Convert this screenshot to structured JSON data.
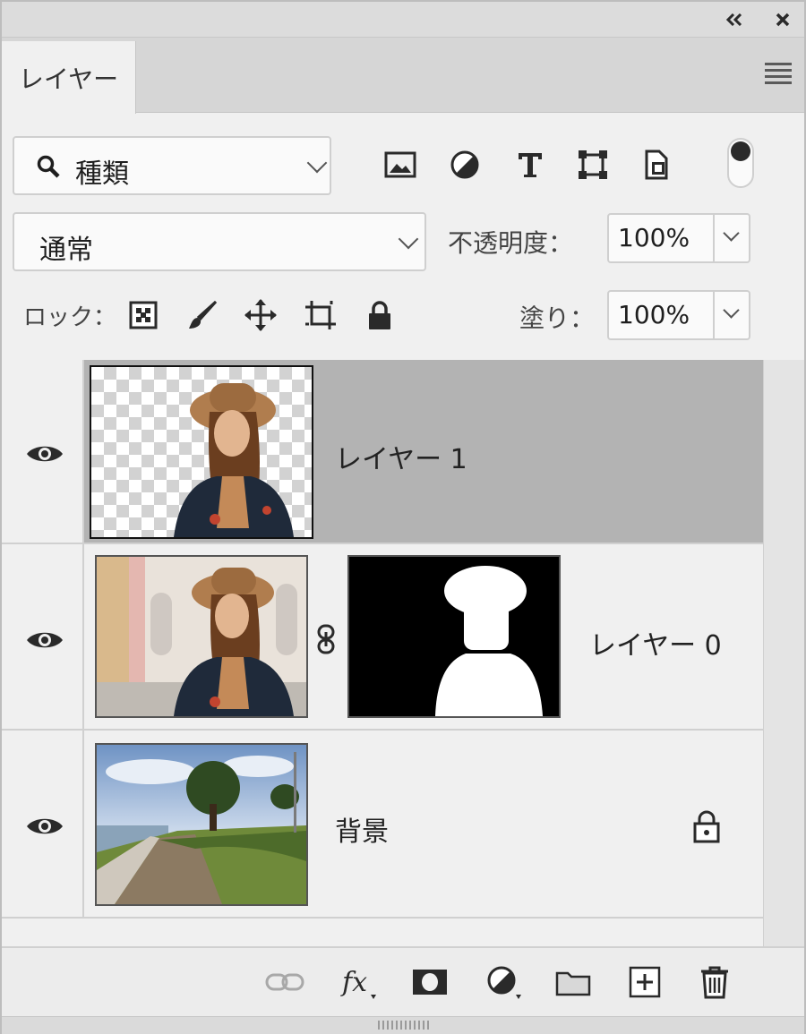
{
  "tab": {
    "label": "レイヤー"
  },
  "filter": {
    "kind_label": "種類"
  },
  "blend": {
    "mode_label": "通常"
  },
  "opacity": {
    "label": "不透明度：",
    "value": "100%"
  },
  "lock": {
    "label": "ロック："
  },
  "fill": {
    "label": "塗り：",
    "value": "100%"
  },
  "layers": [
    {
      "name": "レイヤー 1",
      "selected": true,
      "has_mask": false,
      "locked": false
    },
    {
      "name": "レイヤー 0",
      "selected": false,
      "has_mask": true,
      "locked": false
    },
    {
      "name": "背景",
      "selected": false,
      "has_mask": false,
      "locked": true
    }
  ],
  "colors": {
    "panel_bg": "#f0f0f0",
    "selected_row": "#b3b3b3",
    "icon": "#2a2a2a",
    "disabled_icon": "#a8a8a8"
  },
  "icons": {
    "titlebar": [
      "collapse-icon",
      "close-icon"
    ],
    "filters": [
      "pixel-layer-filter-icon",
      "adjustment-filter-icon",
      "type-filter-icon",
      "shape-filter-icon",
      "smart-object-filter-icon"
    ],
    "lock": [
      "lock-transparent-pixels-icon",
      "lock-image-pixels-icon",
      "lock-position-icon",
      "lock-artboard-icon",
      "lock-all-icon"
    ],
    "footer": [
      "link-layers-icon",
      "fx-icon",
      "add-mask-icon",
      "adjustment-layer-icon",
      "group-folder-icon",
      "new-layer-icon",
      "trash-icon"
    ]
  }
}
